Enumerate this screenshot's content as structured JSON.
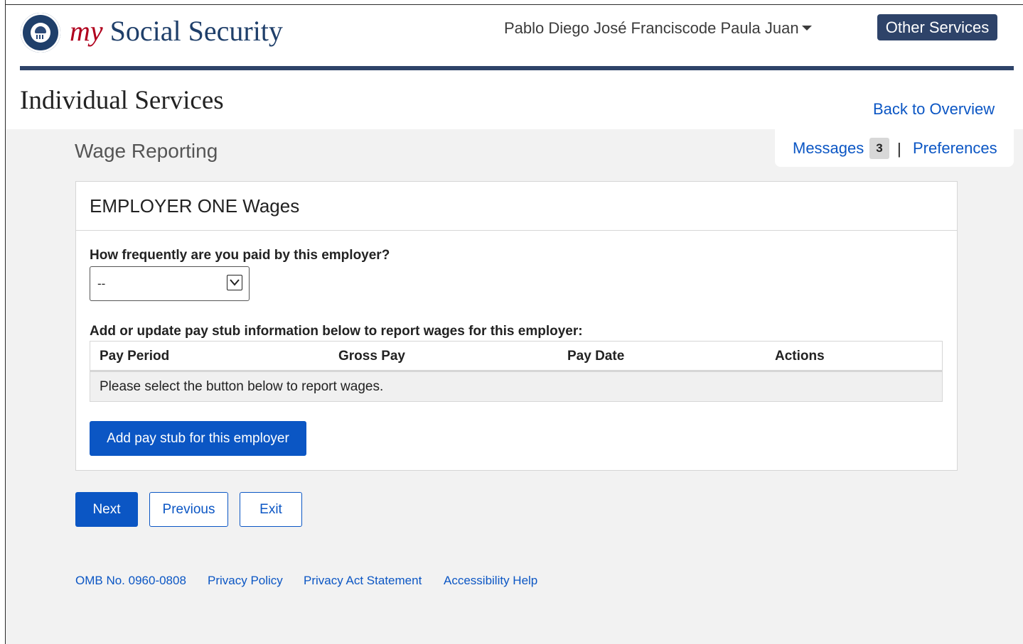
{
  "header": {
    "brand_my": "my",
    "brand_name": "Social Security",
    "user_name": "Pablo Diego José Franciscode Paula Juan",
    "other_services_label": "Other Services",
    "logo_icon": "ssa-seal-icon"
  },
  "page": {
    "title": "Individual Services",
    "back_link": "Back  to Overview",
    "messages_label": "Messages",
    "messages_count": "3",
    "separator": "|",
    "preferences_label": "Preferences",
    "section_title": "Wage Reporting"
  },
  "panel": {
    "title": "EMPLOYER ONE Wages",
    "frequency_question": "How frequently are you paid by this employer?",
    "frequency_selected": "--",
    "add_instructions": "Add or update pay stub information below to report wages for this employer:",
    "table_headers": [
      "Pay Period",
      "Gross Pay",
      "Pay Date",
      "Actions"
    ],
    "empty_message": "Please select the button below to report wages.",
    "add_button_label": "Add pay stub for this employer"
  },
  "nav": {
    "next_label": "Next",
    "previous_label": "Previous",
    "exit_label": "Exit"
  },
  "footer": {
    "omb": "OMB No. 0960-0808",
    "privacy_policy": "Privacy Policy",
    "privacy_act": "Privacy Act Statement",
    "accessibility": "Accessibility Help"
  },
  "colors": {
    "brand_navy": "#2e4369",
    "brand_red": "#b0001d",
    "link_blue": "#0b56c4",
    "band_gray": "#f2f2f2"
  }
}
